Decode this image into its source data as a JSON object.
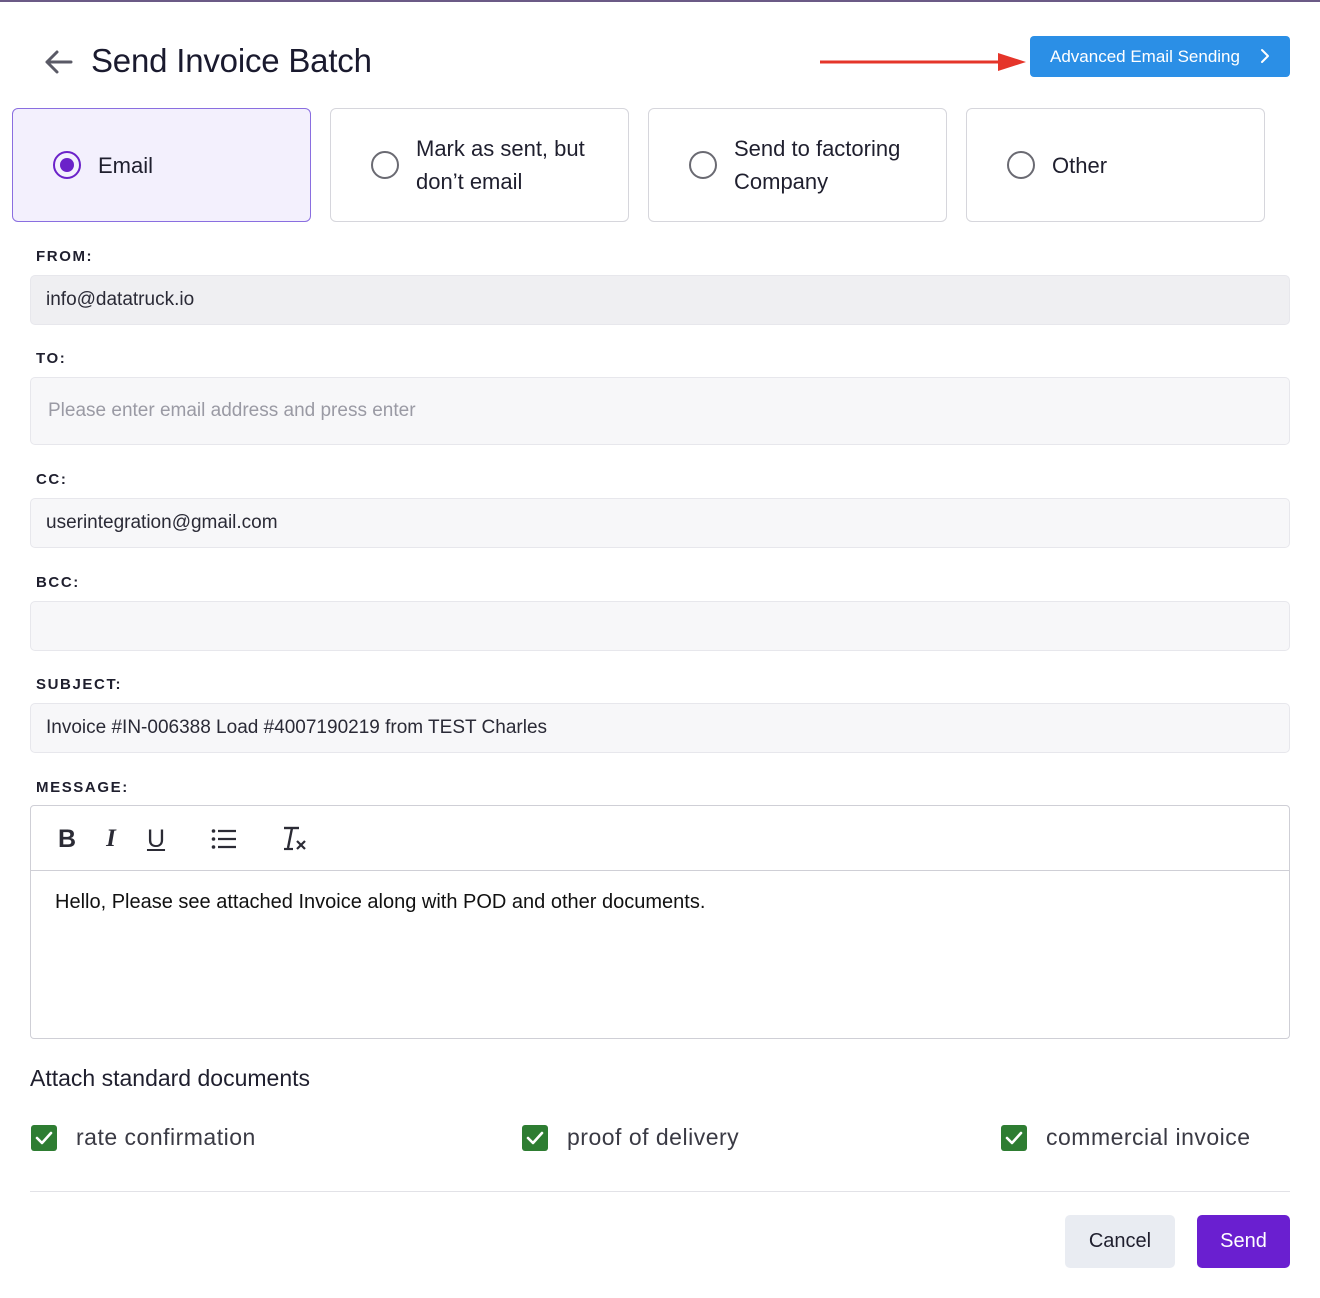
{
  "header": {
    "title": "Send Invoice Batch",
    "advanced_button_label": "Advanced Email Sending"
  },
  "options": [
    {
      "label": "Email",
      "selected": true
    },
    {
      "label": "Mark as sent, but don’t email",
      "selected": false
    },
    {
      "label": "Send to factoring Company",
      "selected": false
    },
    {
      "label": "Other",
      "selected": false
    }
  ],
  "form": {
    "from": {
      "label": "FROM:",
      "value": "info@datatruck.io"
    },
    "to": {
      "label": "TO:",
      "value": "",
      "placeholder": "Please enter email address and press enter"
    },
    "cc": {
      "label": "CC:",
      "value": "userintegration@gmail.com"
    },
    "bcc": {
      "label": "BCC:",
      "value": ""
    },
    "subject": {
      "label": "SUBJECT:",
      "value": "Invoice #IN-006388 Load #4007190219 from TEST Charles"
    },
    "message": {
      "label": "MESSAGE:",
      "value": "Hello, Please see attached Invoice along with POD and other documents."
    }
  },
  "toolbar": [
    "bold-icon",
    "italic-icon",
    "underline-icon",
    "bullet-list-icon",
    "clear-format-icon"
  ],
  "attachments": {
    "title": "Attach standard documents",
    "items": [
      {
        "label": "rate confirmation",
        "checked": true
      },
      {
        "label": "proof of delivery",
        "checked": true
      },
      {
        "label": "commercial invoice",
        "checked": true
      }
    ]
  },
  "footer": {
    "cancel_label": "Cancel",
    "send_label": "Send"
  },
  "colors": {
    "accent": "#6a1fd0",
    "advanced_button": "#2b8fe6",
    "annotation_arrow": "#e5352a",
    "checkbox": "#2e7d32"
  }
}
